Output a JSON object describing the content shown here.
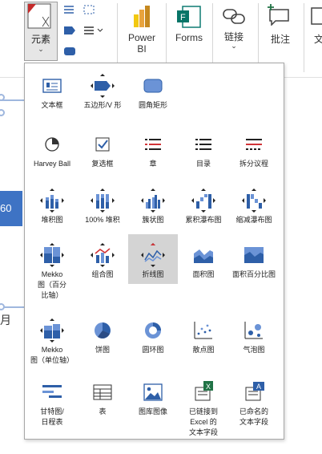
{
  "ribbon": {
    "elements_label": "元素",
    "power_bi_label": "Power\nBI",
    "forms_label": "Forms",
    "link_label": "链接",
    "comment_label": "批注",
    "partial_label": "文"
  },
  "background": {
    "number_text": "60",
    "month_text": "月"
  },
  "gallery": {
    "items": [
      {
        "label": "文本框",
        "icon": "textbox-icon"
      },
      {
        "label": "五边形/V 形",
        "icon": "pentagon-chevron-icon"
      },
      {
        "label": "圆角矩形",
        "icon": "rounded-rectangle-icon"
      },
      {
        "label": "Harvey Ball",
        "icon": "harvey-ball-icon"
      },
      {
        "label": "复选框",
        "icon": "checkbox-icon"
      },
      {
        "label": "章",
        "icon": "chapter-icon"
      },
      {
        "label": "目录",
        "icon": "table-of-contents-icon"
      },
      {
        "label": "拆分议程",
        "icon": "split-agenda-icon"
      },
      {
        "label": "堆积图",
        "icon": "stacked-chart-icon"
      },
      {
        "label": "100% 堆积",
        "icon": "stacked-100-chart-icon"
      },
      {
        "label": "簇状图",
        "icon": "clustered-chart-icon"
      },
      {
        "label": "累积瀑布图",
        "icon": "cumulative-waterfall-icon"
      },
      {
        "label": "缩减瀑布图",
        "icon": "reduced-waterfall-icon"
      },
      {
        "label": "Mekko\n图（百分\n比轴）",
        "icon": "mekko-percent-icon"
      },
      {
        "label": "组合图",
        "icon": "combo-chart-icon"
      },
      {
        "label": "折线图",
        "icon": "line-chart-icon"
      },
      {
        "label": "面积图",
        "icon": "area-chart-icon"
      },
      {
        "label": "面积百分比图",
        "icon": "area-percent-chart-icon"
      },
      {
        "label": "Mekko\n图（单位轴）",
        "icon": "mekko-unit-icon"
      },
      {
        "label": "饼图",
        "icon": "pie-chart-icon"
      },
      {
        "label": "圆环图",
        "icon": "doughnut-chart-icon"
      },
      {
        "label": "散点图",
        "icon": "scatter-chart-icon"
      },
      {
        "label": "气泡图",
        "icon": "bubble-chart-icon"
      },
      {
        "label": "甘特图/\n日程表",
        "icon": "gantt-icon"
      },
      {
        "label": "表",
        "icon": "table-icon"
      },
      {
        "label": "图库图像",
        "icon": "stock-image-icon"
      },
      {
        "label": "已链接到\nExcel 的\n文本字段",
        "icon": "excel-linked-text-icon"
      },
      {
        "label": "已命名的\n文本字段",
        "icon": "named-text-field-icon"
      }
    ],
    "selected_index": 15
  },
  "colors": {
    "accent": "#2e5fa8",
    "accent_light": "#6b93d6",
    "red": "#d13438",
    "green": "#217346",
    "selection": "#d4d4d4"
  }
}
